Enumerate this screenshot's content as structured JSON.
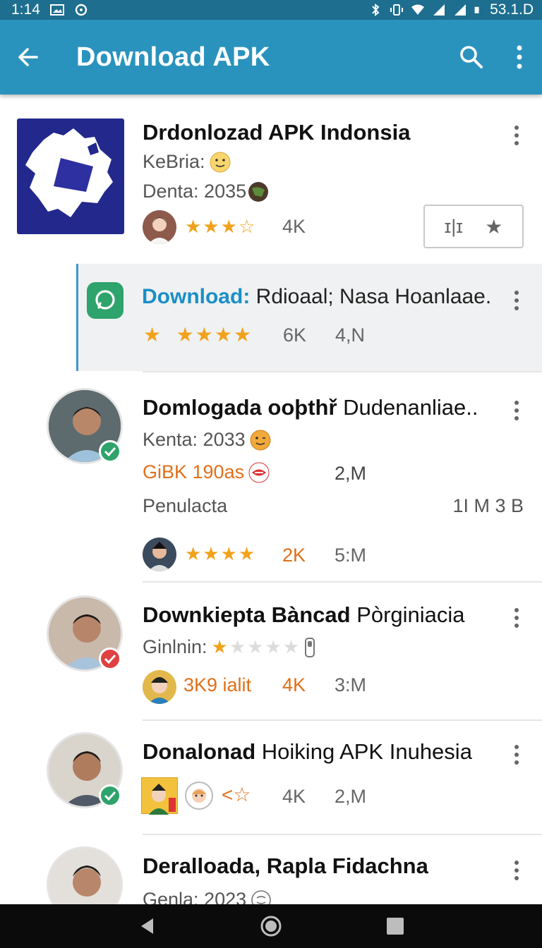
{
  "status_bar": {
    "time": "1:14",
    "battery_text": "53.1.D"
  },
  "app_bar": {
    "title": "Download APK",
    "icons": [
      "back-arrow-icon",
      "search-icon",
      "more-vert-icon"
    ]
  },
  "colors": {
    "app_bar": "#2a93bd",
    "status_bar": "#1d6e8f",
    "star": "#f1a21c",
    "accent_blue": "#1a8fc7",
    "orange": "#e0701a",
    "check_green": "#2ea36b",
    "alert_red": "#e04141"
  },
  "items": [
    {
      "title": "Drdonlozad APK Indonsia",
      "line1": "KeBria:",
      "line2": "Denta: 2035",
      "count": "4K",
      "action_label": "ɪ|ɪ"
    },
    {
      "title_blue": "Download:",
      "title_rest": "Rdioaal; Nasa Hoanlaae.",
      "count1": "6K",
      "count2": "4,N"
    },
    {
      "title": "Domlogada ooþthř",
      "title_rest": "Dudenanliae..",
      "line1": "Kenta: 2033",
      "line2_orange": "GiBK 190as",
      "line2_value": "2,M",
      "line3": "Penulacta",
      "line3_value": "1I M 3 B",
      "count1": "2K",
      "count2": "5:M"
    },
    {
      "title": "Downkiepta Bàncad",
      "title_rest": "Pòrginiacia",
      "line1": "Ginlnin:",
      "line2_orange": "3K9 ialit",
      "count1": "4K",
      "count2": "3:M"
    },
    {
      "title": "Donalonad",
      "title_rest": "Hoiking APK Inuhesia",
      "count1": "4K",
      "count2": "2,M"
    },
    {
      "title": "Deralloada, Rapla Fidachna",
      "line1": "Genla: 2023"
    }
  ]
}
